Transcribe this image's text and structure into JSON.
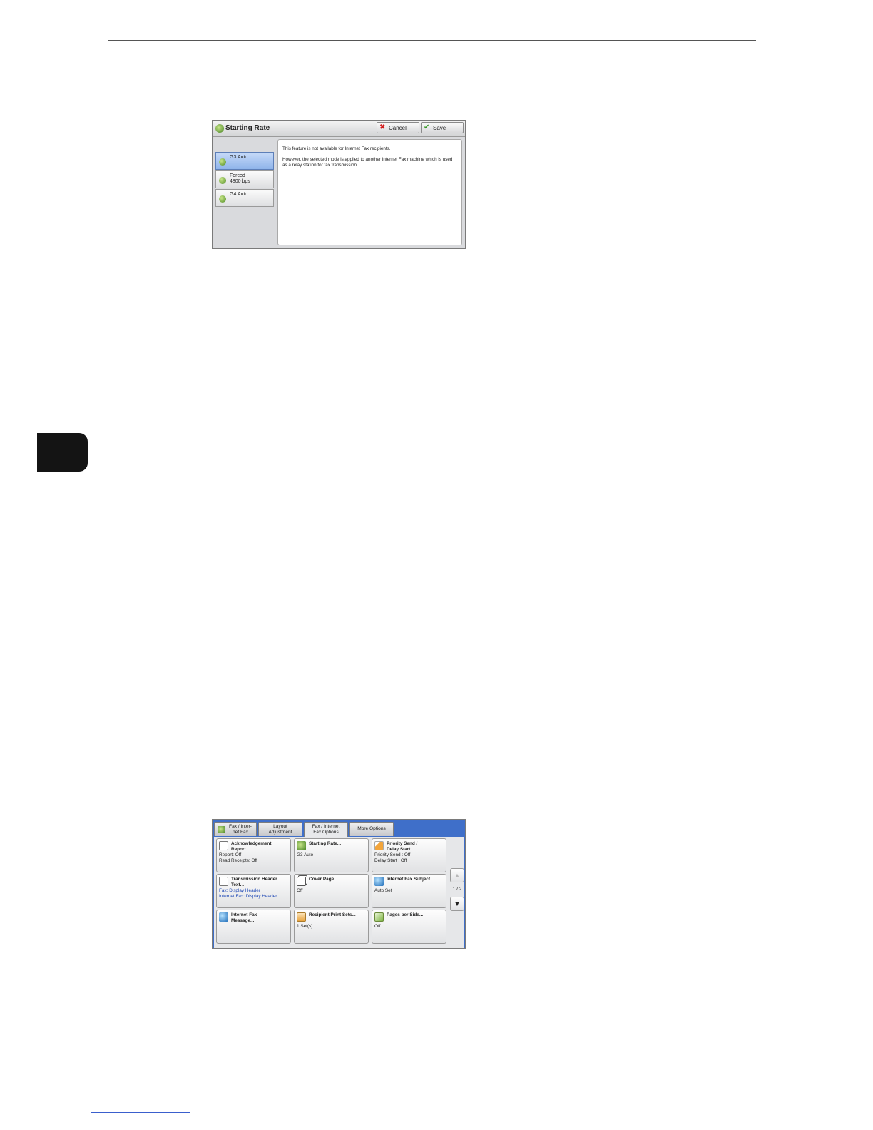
{
  "starting_rate_dialog": {
    "title": "Starting Rate",
    "cancel_label": "Cancel",
    "save_label": "Save",
    "options": [
      {
        "label": "G3 Auto",
        "selected": true
      },
      {
        "label": "Forced\n4800 bps",
        "selected": false
      },
      {
        "label": "G4 Auto",
        "selected": false
      }
    ],
    "info_line_1": "This feature is not available for Internet Fax recipients.",
    "info_line_2": "However, the selected mode is applied to another Internet Fax machine which is used as a relay station for fax transmission."
  },
  "fax_options_screen": {
    "tabs": [
      {
        "label": "Fax / Inter-\nnet Fax",
        "active": false
      },
      {
        "label": "Layout\nAdjustment",
        "active": false
      },
      {
        "label": "Fax / Internet\nFax Options",
        "active": true
      },
      {
        "label": "More Options",
        "active": false
      }
    ],
    "buttons": [
      {
        "title": "Acknowledgement\nReport...",
        "value": "Report: Off\nRead Receipts: Off",
        "icon": "report-icon"
      },
      {
        "title": "Starting Rate...",
        "value": "G3 Auto",
        "icon": "starting-rate-icon"
      },
      {
        "title": "Priority Send /\nDelay Start...",
        "value": "Priority Send : Off\nDelay Start : Off",
        "icon": "priority-send-icon"
      },
      {
        "title": "Transmission Header\nText...",
        "value": "Fax: Display Header\nInternet Fax: Display Header",
        "icon": "header-text-icon"
      },
      {
        "title": "Cover Page...",
        "value": "Off",
        "icon": "cover-page-icon"
      },
      {
        "title": "Internet Fax Subject...",
        "value": "Auto Set",
        "icon": "internet-fax-icon"
      },
      {
        "title": "Internet Fax\nMessage...",
        "value": "",
        "icon": "internet-fax-icon"
      },
      {
        "title": "Recipient Print Sets...",
        "value": "1 Set(s)",
        "icon": "print-sets-icon"
      },
      {
        "title": "Pages per Side...",
        "value": "Off",
        "icon": "pages-per-side-icon"
      }
    ],
    "page_indicator": "1 / 2",
    "scroll_up_label": "▲",
    "scroll_down_label": "▼"
  },
  "colors": {
    "selected_option": "#8fb4ea",
    "screen_frame_blue": "#3f6fc9",
    "value_blue_text": "#1f48b5",
    "side_tab": "#141414"
  }
}
